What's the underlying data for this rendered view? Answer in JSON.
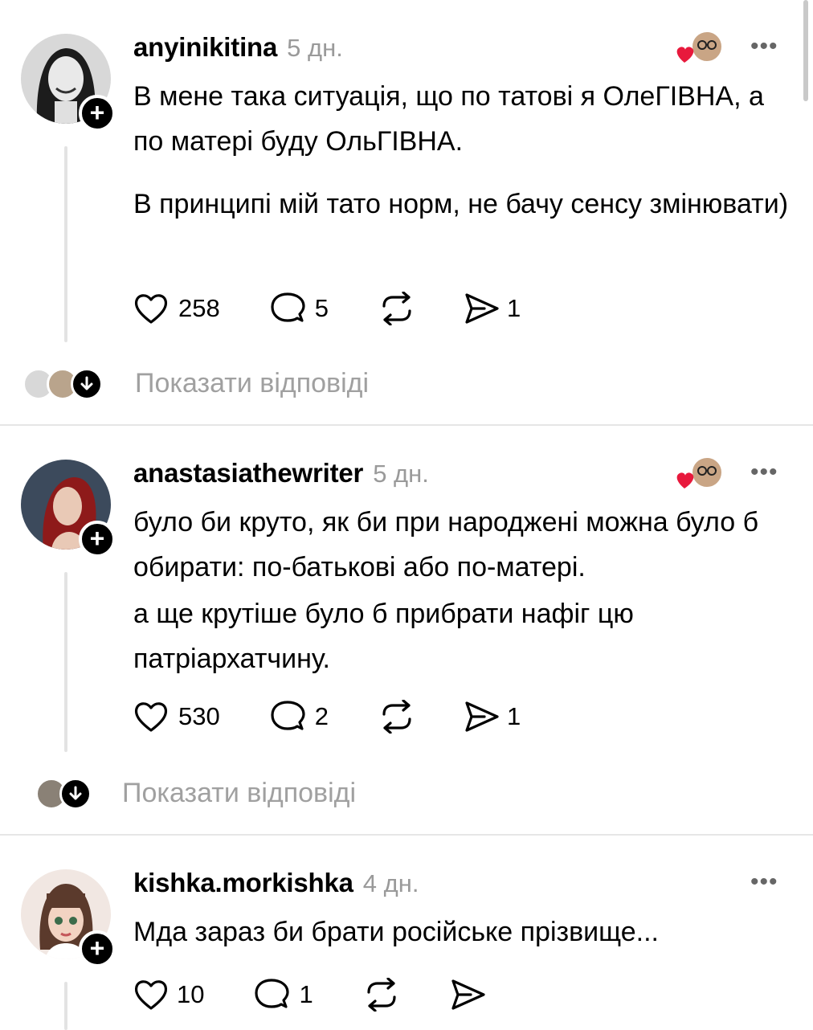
{
  "comments": [
    {
      "username": "anyinikitina",
      "time": "5 дн.",
      "paragraphs": [
        "В мене така ситуація, що по татові я ОлеГІВНА, а по матері буду ОльГІВНА.",
        "В принципі мій тато норм, не бачу сенсу змінювати)"
      ],
      "likes": "258",
      "replies": "5",
      "shares": "1",
      "show_replies": "Показати відповіді"
    },
    {
      "username": "anastasiathewriter",
      "time": "5 дн.",
      "paragraphs": [
        "було би круто, як би при народжені можна було б обирати: по-батькові або по-матері.",
        "а ще крутіше було б прибрати нафіг цю патріархатчину."
      ],
      "likes": "530",
      "replies": "2",
      "shares": "1",
      "show_replies": "Показати відповіді"
    },
    {
      "username": "kishka.morkishka",
      "time": "4 дн.",
      "paragraphs": [
        "Мда зараз би брати російське прізвище..."
      ],
      "likes": "10",
      "replies": "1",
      "shares": ""
    }
  ],
  "ui": {
    "more_glyph": "•••",
    "plus_glyph": "+",
    "liked_color": "#e8193c"
  }
}
